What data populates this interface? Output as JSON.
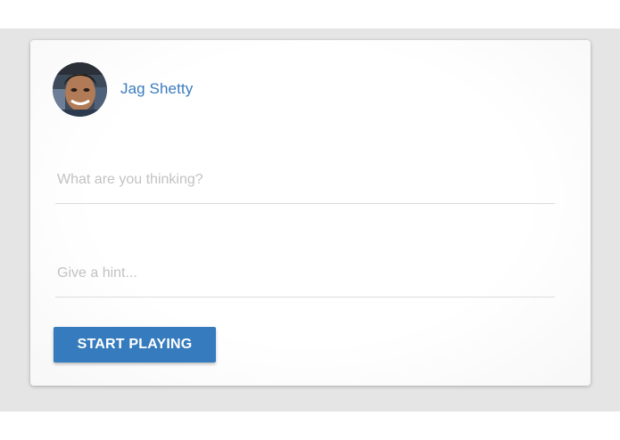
{
  "profile": {
    "name": "Jag Shetty",
    "avatar_icon": "user-avatar-photo"
  },
  "form": {
    "thought_placeholder": "What are you thinking?",
    "thought_value": "",
    "hint_placeholder": "Give a hint...",
    "hint_value": ""
  },
  "actions": {
    "start_label": "START PLAYING"
  },
  "colors": {
    "accent": "#357bbd",
    "name_text": "#3a7bbf",
    "background": "#e5e5e5",
    "card": "#ffffff"
  }
}
